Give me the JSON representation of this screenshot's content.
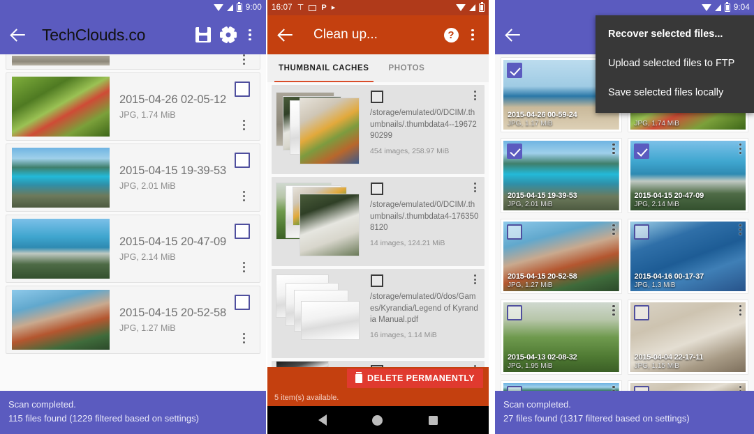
{
  "panel1": {
    "statusbar": {
      "time": "9:00",
      "icons": [
        "wifi-icon",
        "signal-icon",
        "battery-icon"
      ]
    },
    "appbar": {
      "title": "TechClouds.co",
      "back": "back-arrow",
      "save": "save-icon",
      "settings": "gear-icon",
      "overflow": "overflow-menu"
    },
    "items": [
      {
        "title": "",
        "sub": "",
        "partial": true,
        "pic": "pic-grey"
      },
      {
        "title": "2015-04-26 02-05-12",
        "sub": "JPG, 1.74 MiB",
        "pic": "pic-berries",
        "checked": false
      },
      {
        "title": "2015-04-15 19-39-53",
        "sub": "JPG, 2.01 MiB",
        "pic": "pic-bay1",
        "checked": false
      },
      {
        "title": "2015-04-15 20-47-09",
        "sub": "JPG, 2.14 MiB",
        "pic": "pic-bay2",
        "checked": false
      },
      {
        "title": "2015-04-15 20-52-58",
        "sub": "JPG, 1.27 MiB",
        "pic": "pic-selfie",
        "checked": false
      }
    ],
    "snackbar": {
      "line1": "Scan completed.",
      "line2": "115 files found (1229 filtered based on settings)"
    }
  },
  "panel2": {
    "statusbar": {
      "time": "16:07",
      "icons": [
        "antenna-icon",
        "camera-icon",
        "p-icon",
        "play-icon",
        "wifi-icon",
        "signal-icon",
        "battery-icon"
      ]
    },
    "appbar": {
      "title": "Clean up...",
      "back": "back-arrow",
      "help": "help-icon",
      "overflow": "overflow-menu"
    },
    "tabs": [
      {
        "label": "THUMBNAIL CACHES",
        "active": true
      },
      {
        "label": "PHOTOS",
        "active": false
      }
    ],
    "items": [
      {
        "path": "/storage/emulated/0/DCIM/.thumbnails/.thumbdata4--1967290299",
        "sub": "454 images, 258.97 MiB",
        "pic": "pic-food",
        "checked": false
      },
      {
        "path": "/storage/emulated/0/DCIM/.thumbnails/.thumbdata4-1763508120",
        "sub": "14 images, 124.21 MiB",
        "pic": "pic-cat",
        "checked": false
      },
      {
        "path": "/storage/emulated/0/dos/Games/Kyrandia/Legend of Kyrandia Manual.pdf",
        "sub": "16 images, 1.14 MiB",
        "pic": "pic-doc",
        "checked": false
      },
      {
        "path": "",
        "sub": "",
        "pic": "pic-bw",
        "partial": true,
        "checked": false
      }
    ],
    "actionbar": {
      "delete_label": "DELETE PERMANENTLY",
      "delete_icon": "trash-icon",
      "available": "5 item(s) available."
    },
    "navbar": {
      "back": "nav-back-icon",
      "home": "nav-home-icon",
      "recents": "nav-recents-icon"
    }
  },
  "panel3": {
    "statusbar": {
      "time": "9:04",
      "icons": [
        "wifi-icon",
        "signal-icon",
        "battery-icon"
      ]
    },
    "appbar": {
      "back": "back-arrow"
    },
    "menu": [
      {
        "label": "Recover selected files...",
        "bold": true
      },
      {
        "label": "Upload selected files to FTP",
        "bold": false
      },
      {
        "label": "Save selected files locally",
        "bold": false
      }
    ],
    "items": [
      {
        "title": "2015-04-26 00-59-24",
        "sub": "JPG, 1.17 MiB",
        "pic": "pic-beach",
        "checked": true
      },
      {
        "title": "",
        "sub": "JPG, 1.74 MiB",
        "pic": "pic-berries",
        "checked": true
      },
      {
        "title": "2015-04-15 19-39-53",
        "sub": "JPG, 2.01 MiB",
        "pic": "pic-bay1",
        "checked": true
      },
      {
        "title": "2015-04-15 20-47-09",
        "sub": "JPG, 2.14 MiB",
        "pic": "pic-bay2",
        "checked": true
      },
      {
        "title": "2015-04-15 20-52-58",
        "sub": "JPG, 1.27 MiB",
        "pic": "pic-selfie",
        "checked": false
      },
      {
        "title": "2015-04-16 00-17-37",
        "sub": "JPG, 1.3 MiB",
        "pic": "pic-boat",
        "checked": false
      },
      {
        "title": "2015-04-13 02-08-32",
        "sub": "JPG, 1.95 MiB",
        "pic": "pic-sheep",
        "checked": false
      },
      {
        "title": "2015-04-04 22-17-11",
        "sub": "JPG, 1.15 MiB",
        "pic": "pic-dog",
        "checked": false
      },
      {
        "title": "",
        "sub": "",
        "pic": "pic-bay1",
        "checked": false,
        "partial": true
      },
      {
        "title": "",
        "sub": "",
        "pic": "pic-dog",
        "checked": false,
        "partial": true
      }
    ],
    "snackbar": {
      "line1": "Scan completed.",
      "line2": "27 files found (1317 filtered based on settings)"
    }
  },
  "colors": {
    "purple": "#5b5bbf",
    "orange_bar": "#c4400f",
    "orange_status": "#b03a1a",
    "red_delete": "#e03a2f",
    "menu_bg": "#383838",
    "tab_indicator": "#d94d2a"
  }
}
